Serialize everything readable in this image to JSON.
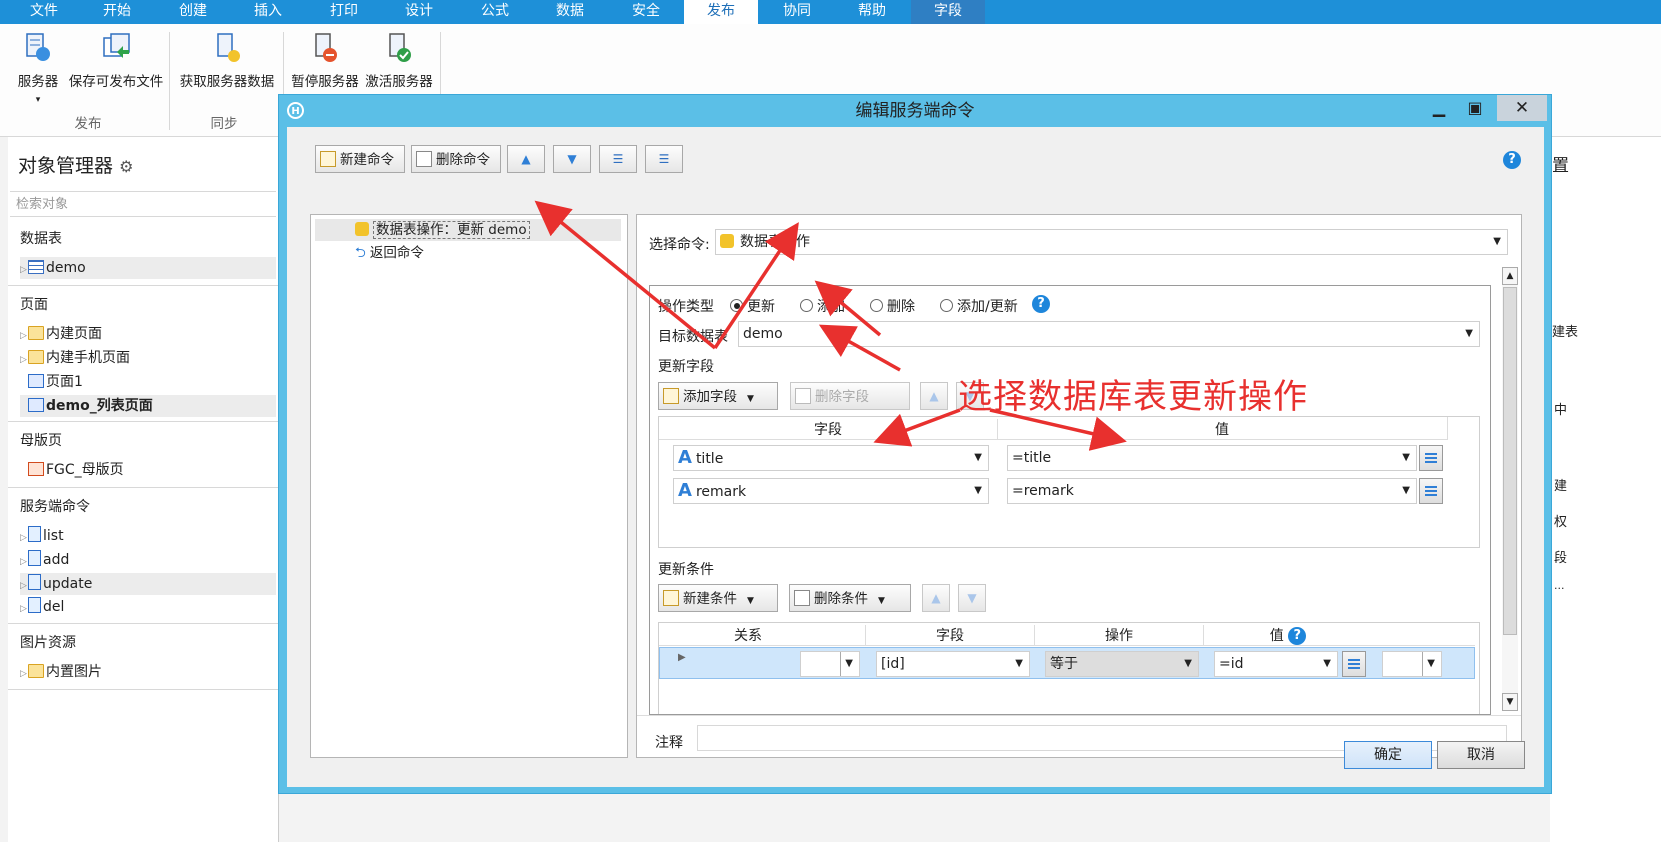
{
  "menu": [
    "文件",
    "开始",
    "创建",
    "插入",
    "打印",
    "设计",
    "公式",
    "数据",
    "安全",
    "发布",
    "协同",
    "帮助",
    "字段"
  ],
  "ribbon": {
    "buttons": [
      "服务器",
      "保存可发布文件",
      "获取服务器数据",
      "暂停服务器",
      "激活服务器"
    ],
    "groups": [
      "发布",
      "同步"
    ]
  },
  "left": {
    "title": "对象管理器",
    "search_placeholder": "检索对象",
    "sections": {
      "tables": "数据表",
      "pages": "页面",
      "master": "母版页",
      "server_cmds": "服务端命令",
      "images": "图片资源"
    },
    "table_items": [
      "demo"
    ],
    "page_items": [
      "内建页面",
      "内建手机页面",
      "页面1",
      "demo_列表页面"
    ],
    "master_items": [
      "FGC_母版页"
    ],
    "cmd_items": [
      "list",
      "add",
      "update",
      "del"
    ],
    "image_items": [
      "内置图片"
    ]
  },
  "right_peek": [
    "置",
    "建表",
    "中",
    "建",
    "权",
    "段",
    "..."
  ],
  "dialog": {
    "title": "编辑服务端命令",
    "toolbar": {
      "new_cmd": "新建命令",
      "del_cmd": "删除命令"
    },
    "tree": [
      "数据表操作：更新 demo",
      "返回命令"
    ],
    "select_cmd_label": "选择命令:",
    "select_cmd_value": "数据表操作",
    "op_type_label": "操作类型",
    "op_types": [
      "更新",
      "添加",
      "删除",
      "添加/更新"
    ],
    "target_label": "目标数据表",
    "target_value": "demo",
    "update_fields_label": "更新字段",
    "add_field": "添加字段",
    "del_field": "删除字段",
    "fields_head": [
      "字段",
      "值"
    ],
    "fields": [
      {
        "field": "title",
        "value": "=title"
      },
      {
        "field": "remark",
        "value": "=remark"
      }
    ],
    "cond_label": "更新条件",
    "new_cond": "新建条件",
    "del_cond": "删除条件",
    "cond_head": [
      "关系",
      "字段",
      "操作",
      "值"
    ],
    "cond_row": {
      "field": "[id]",
      "op": "等于",
      "value": "=id"
    },
    "note_label": "注释",
    "ok": "确定",
    "cancel": "取消"
  },
  "annotation": "选择数据库表更新操作"
}
